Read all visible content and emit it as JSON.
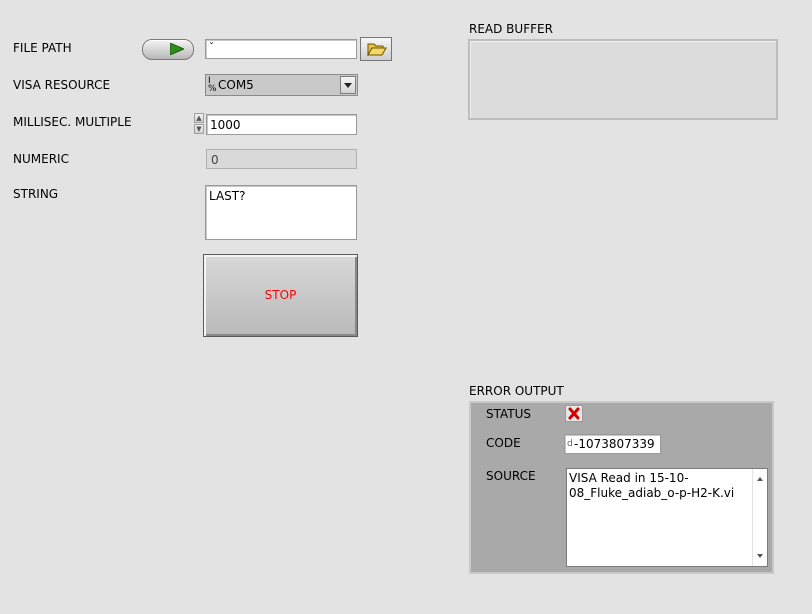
{
  "controls": {
    "file_path": {
      "label": "FILE PATH",
      "value": ""
    },
    "visa_resource": {
      "label": "VISA RESOURCE",
      "value": "COM5",
      "prefix_icon": "visa-resource-icon"
    },
    "millisec_multiple": {
      "label": "MILLISEC. MULTIPLE",
      "value": "1000"
    },
    "numeric": {
      "label": "NUMERIC",
      "value": "0"
    },
    "string": {
      "label": "STRING",
      "value": "LAST?"
    },
    "stop_button": {
      "label": "STOP",
      "color": "#ff0000"
    }
  },
  "read_buffer": {
    "label": "READ BUFFER",
    "value": ""
  },
  "error_output": {
    "label": "ERROR OUTPUT",
    "status_label": "STATUS",
    "status_icon": "error-x-icon",
    "code_label": "CODE",
    "code_value": "-1073807339",
    "source_label": "SOURCE",
    "source_value": "VISA Read in 15-10-08_Fluke_adiab_o-p-H2-K.vi"
  },
  "colors": {
    "background": "#e3e3e3",
    "error_panel": "#a9a9a9",
    "stop_text": "#ff0000",
    "status_x": "#d40000",
    "run_arrow": "#2e8b1e"
  }
}
